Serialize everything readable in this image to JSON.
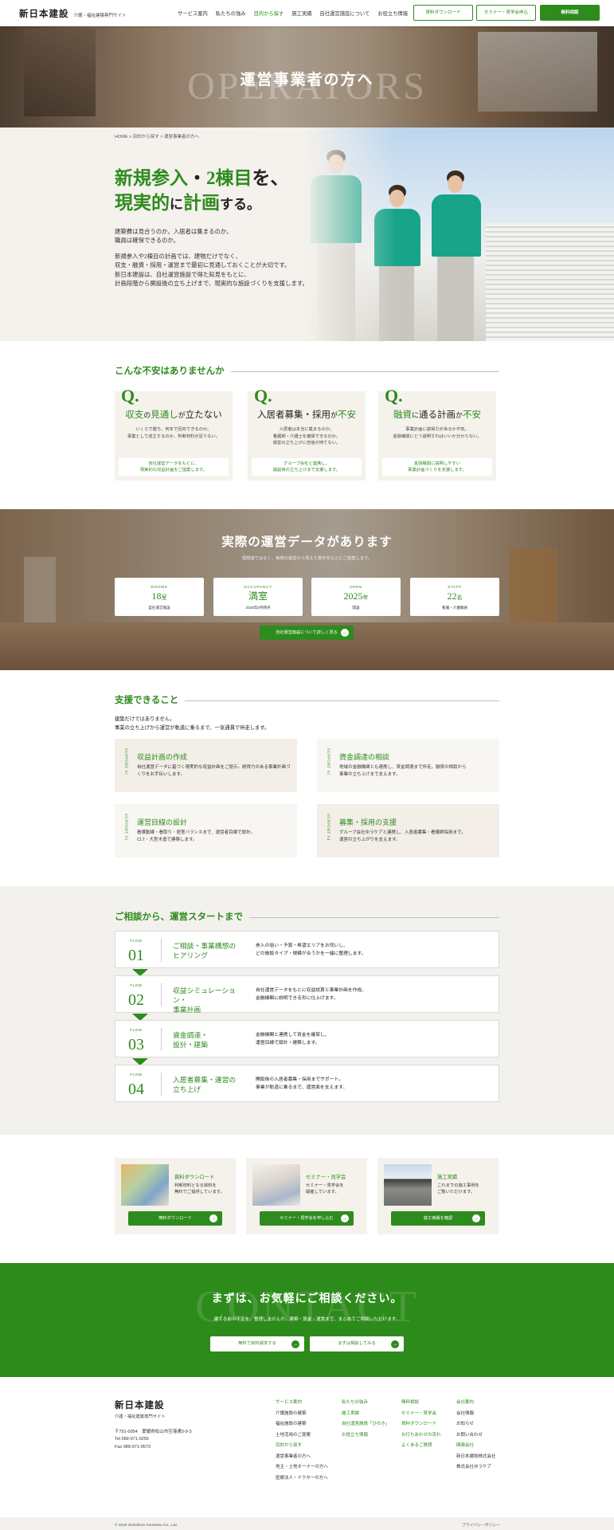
{
  "header": {
    "logo_main": "新日本建設",
    "logo_sub": "介護・福祉建築専門サイト",
    "nav": [
      "サービス案内",
      "私たちの強み",
      "目的から探す",
      "施工実績",
      "自社運営施設について",
      "お役立ち情報"
    ],
    "btn_download": "資料ダウンロード",
    "btn_seminar": "セミナー・見学会申込",
    "btn_consult": "無料相談"
  },
  "hero": {
    "bg_word": "OPERATORS",
    "title": "運営事業者の方へ"
  },
  "breadcrumb": "HOME  >  目的から探す  >  運営事業者の方へ",
  "intro": {
    "h1_a1": "新規参入",
    "h1_a2": "・",
    "h1_a3": "2棟目",
    "h1_a4": "を、",
    "h1_b1": "現実的",
    "h1_b2": "に",
    "h1_b3": "計画",
    "h1_b4": "する。",
    "p1": "建築費は見合うのか。入居者は集まるのか。\n職員は確保できるのか。",
    "p2": "新規参入や2棟目の計画では、建物だけでなく、\n収支・融資・採用・運営まで最初に見通しておくことが大切です。\n新日本建設は、自社運営施設で得た知見をもとに、\n計画段階から開設後の立ち上げまで、現実的な施設づくりを支援します。"
  },
  "worries": {
    "heading": "こんな不安はありませんか",
    "items": [
      {
        "q": "Q.",
        "t1": "収支",
        "t2": "の",
        "t3": "見通し",
        "t4": "が",
        "t5": "立たない",
        "desc": "いくらで建ち、何年で回収できるのか。\n事業として成立するのか、判断材料が足りない。",
        "answer": "自社運営データをもとに、\n現実的な収益計画をご提案します。"
      },
      {
        "q": "Q.",
        "t1": "入居者募集・採用",
        "t2": "が",
        "t3": "不安",
        "t4": "",
        "t5": "",
        "desc": "入居者は本当に集まるのか。\n看護師・介護士を確保できるのか。\n運営の立ち上げに自信が持てない。",
        "answer": "グループ会社と連携し、\n開設後の立ち上げまで支援します。"
      },
      {
        "q": "Q.",
        "t1": "融資",
        "t2": "に",
        "t3": "通る計画",
        "t4": "か",
        "t5": "不安",
        "desc": "事業計画に説得力があるか不安。\n金融機関にどう説明すればいいか分からない。",
        "answer": "金融機関に説明しやすい\n事業計画づくりを支援します。"
      }
    ]
  },
  "data": {
    "title": "実際の運営データがあります",
    "sub": "理想値ではなく、実際の運営から見えた数字をもとにご提案します。",
    "cards": [
      {
        "label": "ROOMS",
        "value": "18",
        "unit": "室",
        "note": "自社運営施設"
      },
      {
        "label": "OCCUPANCY",
        "value": "満室",
        "unit": "",
        "note": "2026年8月時点"
      },
      {
        "label": "OPEN",
        "value": "2025",
        "unit": "年",
        "note": "開設"
      },
      {
        "label": "STAFF",
        "value": "22",
        "unit": "名",
        "note": "看護・介護職員"
      }
    ],
    "btn": "自社運営施設について詳しく見る",
    "btn_icon": "→"
  },
  "support": {
    "heading": "支援できること",
    "sub": "建築だけではありません。\n事業の立ち上げから運営が軌道に乗るまで、一気通貫で伴走します。",
    "items": [
      {
        "tag": "SUPPORT 01",
        "title": "収益計画の作成",
        "desc": "自社運営データに基づく現実的な収益計画をご提示。説得力のある事業計画づくりをお手伝いします。"
      },
      {
        "tag": "SUPPORT 02",
        "title": "資金調達の相談",
        "desc": "地域の金融機関とも連携し、資金調達まで伴走。融資の相談から\n事業の立ち上げまで支えます。"
      },
      {
        "tag": "SUPPORT 03",
        "title": "運営目線の設計",
        "desc": "看護動線・看取り・居室バランスまで、運営者目線で設計。\nCLT・大型木造で建築します。"
      },
      {
        "tag": "SUPPORT 04",
        "title": "募集・採用の支援",
        "desc": "グループ会社ゆラケアと連携し、入居者募集・看護師採用まで。\n運営の立ち上がりを支えます。"
      }
    ]
  },
  "flow": {
    "heading": "ご相談から、運営スタートまで",
    "steps": [
      {
        "label": "FLOW",
        "num": "01",
        "title": "ご相談・事業構想の\nヒアリング",
        "desc": "参入の狙い・予算・希望エリアをお伺いし、\nどの施設タイプ・規模が合うかを一緒に整理します。"
      },
      {
        "label": "FLOW",
        "num": "02",
        "title": "収益シミュレーション・\n事業計画",
        "desc": "自社運営データをもとに収益試算と事業計画を作成。\n金融機関に説明できる形に仕上げます。"
      },
      {
        "label": "FLOW",
        "num": "03",
        "title": "資金調達・\n設計・建築",
        "desc": "金融機関と連携して資金を確保し、\n運営目線で設計・建築します。"
      },
      {
        "label": "FLOW",
        "num": "04",
        "title": "入居者募集・運営の\n立ち上げ",
        "desc": "開設後の入居者募集・採用までサポート。\n事業が軌道に乗るまで、運営面を支えます。"
      }
    ]
  },
  "cta": {
    "items": [
      {
        "title": "資料ダウンロード",
        "desc": "判断材料となる資料を\n無料でご提供しています。",
        "btn": "無料ダウンロード",
        "icon": "↓"
      },
      {
        "title": "セミナー・見学会",
        "desc": "セミナー・見学会を\n開催しています。",
        "btn": "セミナー・見学会を申し込む",
        "icon": "→"
      },
      {
        "title": "施工実績",
        "desc": "これまでの施工事例を\nご覧いただけます。",
        "btn": "施工実績を確認",
        "icon": "→"
      }
    ]
  },
  "contact": {
    "bg_word": "CONTACT",
    "title": "まずは、お気軽にご相談ください。",
    "sub": "建てる前の不安を、整理しませんか。建築・資金・運営まで、まとめてご相談いただけます。",
    "btn1": "無料で資料請求する",
    "btn2": "まずは相談してみる",
    "icon": "→"
  },
  "footer": {
    "logo_main": "新日本建設",
    "logo_sub": "介護・福祉建築専門サイト",
    "address": "〒791-0054　愛媛県松山市空港通3-9-3\nTel 089-971-0255\nFax 089-971-0573",
    "col1": {
      "h1": "サービス案内",
      "items1": [
        "介護施設の建築",
        "福祉施設の建築",
        "土地活用のご提案"
      ],
      "h2": "目的から探す",
      "items2": [
        "運営事業者の方へ",
        "地主・土地オーナーの方へ",
        "医療法人・ドクターの方へ"
      ]
    },
    "col2": {
      "items": [
        "私たちの強み",
        "施工実績",
        "自社運営施設「ひのき」",
        "お役立ち情報"
      ]
    },
    "col3": {
      "items": [
        "無料相談",
        "セミナー・見学会",
        "資料ダウンロード",
        "お打ちあわせの流れ",
        "よくあるご質問"
      ]
    },
    "col4": {
      "h1": "会社案内",
      "items1": [
        "会社情報",
        "お知らせ",
        "お問い合わせ"
      ],
      "h2": "関連会社",
      "items2": [
        "新日本建設株式会社",
        "株式会社ゆラケア"
      ]
    },
    "copyright": "© 2026 Shinnihon Kensetsu Co., Ltd.",
    "privacy": "プライバシーポリシー"
  },
  "colors": {
    "accent": "#2e8b1e",
    "beige": "#f5f1ec"
  }
}
